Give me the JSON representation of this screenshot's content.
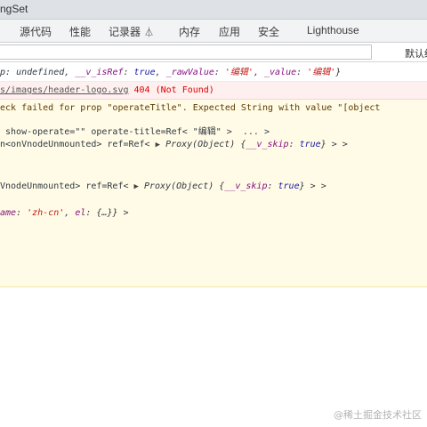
{
  "window": {
    "title": "ngSet"
  },
  "tabs": [
    {
      "label": "源代码"
    },
    {
      "label": "性能"
    },
    {
      "label": "记录器"
    },
    {
      "label": "内存"
    },
    {
      "label": "应用"
    },
    {
      "label": "安全"
    },
    {
      "label": "Lighthouse"
    }
  ],
  "filter": {
    "level_label": "默认级"
  },
  "console": {
    "log_line": {
      "prefix": "p: ",
      "p_val": "undefined",
      "sep1": ", ",
      "k1": "__v_isRef",
      "c1": ": ",
      "v1": "true",
      "sep2": ", ",
      "k2": "_rawValue",
      "c2": ": ",
      "v2": "'编辑'",
      "sep3": ", ",
      "k3": "_value",
      "c3": ": ",
      "v3": "'编辑'",
      "suffix": "}"
    },
    "error_line": {
      "url": "s/images/header-logo.svg",
      "status": " 404 (Not Found)"
    },
    "warn_line1": "eck failed for prop \"operateTitle\". Expected String with value \"[object",
    "warn_line2a": " show-operate=\"\" operate-title=Ref< \"编辑\" >  ... >",
    "warn_line3a": "n<onVnodeUnmounted> ref=Ref< ",
    "warn_line3b": "Proxy(Object)",
    "warn_line3c": " {",
    "warn_line3d": "__v_skip",
    "warn_line3e": ": ",
    "warn_line3f": "true",
    "warn_line3g": "} > >",
    "warn_line4a": "VnodeUnmounted> ref=Ref< ",
    "warn_line4b": "Proxy(Object)",
    "warn_line4c": " {",
    "warn_line4d": "__v_skip",
    "warn_line4e": ": ",
    "warn_line4f": "true",
    "warn_line4g": "} > >",
    "warn_line5a": "ame",
    "warn_line5b": ": ",
    "warn_line5c": "'zh-cn'",
    "warn_line5d": ", ",
    "warn_line5e": "el",
    "warn_line5f": ": {…}} >"
  },
  "watermark": "@稀土掘金技术社区"
}
